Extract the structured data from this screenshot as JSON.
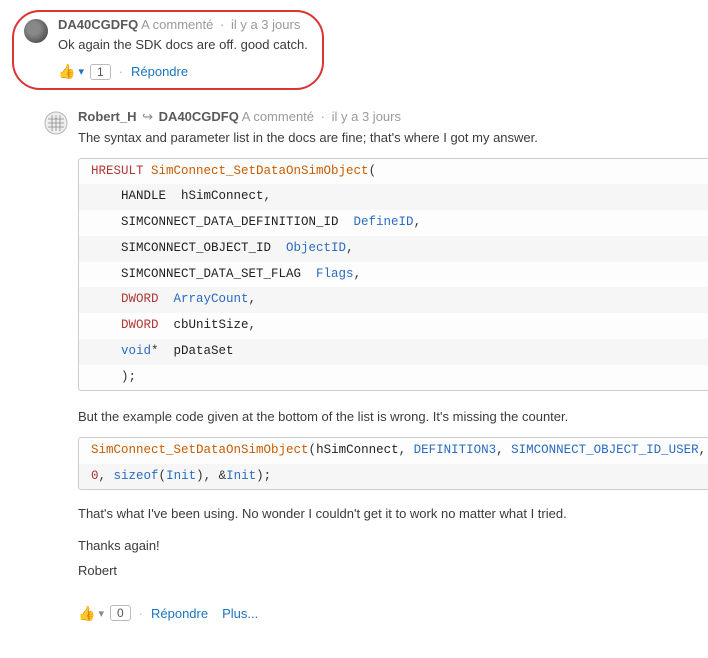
{
  "comments": [
    {
      "author": "DA40CGDFQ",
      "action": "A commenté",
      "time": "il y a 3 jours",
      "text": "Ok again the SDK docs are off. good catch.",
      "vote_count": "1",
      "reply_label": "Répondre"
    },
    {
      "author": "Robert_H",
      "reply_to": "DA40CGDFQ",
      "action": "A commenté",
      "time": "il y a 3 jours",
      "intro": "The syntax and parameter list in the docs are fine; that's where I got my answer.",
      "mid_para": "But the example code given at the bottom of the list is wrong. It's missing the counter.",
      "out_para": "That's what I've been using. No wonder I couldn't get it to work no matter what I tried.",
      "thanks": "Thanks again!",
      "sig": "Robert",
      "vote_count": "0",
      "reply_label": "Répondre",
      "more_label": "Plus..."
    }
  ],
  "code_block_1": [
    [
      [
        "t-type",
        "HRESULT "
      ],
      [
        "t-func",
        "SimConnect_SetDataOnSimObject"
      ],
      [
        "t-pun",
        "("
      ]
    ],
    [
      [
        "t-par",
        "    HANDLE  hSimConnect"
      ],
      [
        "t-pun",
        ","
      ]
    ],
    [
      [
        "t-par",
        "    SIMCONNECT_DATA_DEFINITION_ID  "
      ],
      [
        "t-id",
        "DefineID"
      ],
      [
        "t-pun",
        ","
      ]
    ],
    [
      [
        "t-par",
        "    SIMCONNECT_OBJECT_ID  "
      ],
      [
        "t-id",
        "ObjectID"
      ],
      [
        "t-pun",
        ","
      ]
    ],
    [
      [
        "t-par",
        "    SIMCONNECT_DATA_SET_FLAG  "
      ],
      [
        "t-id",
        "Flags"
      ],
      [
        "t-pun",
        ","
      ]
    ],
    [
      [
        "t-type",
        "    DWORD  "
      ],
      [
        "t-id",
        "ArrayCount"
      ],
      [
        "t-pun",
        ","
      ]
    ],
    [
      [
        "t-type",
        "    DWORD  "
      ],
      [
        "t-par",
        "cbUnitSize"
      ],
      [
        "t-pun",
        ","
      ]
    ],
    [
      [
        "t-kw",
        "    void"
      ],
      [
        "t-pun",
        "*  "
      ],
      [
        "t-par",
        "pDataSet"
      ]
    ],
    [
      [
        "t-pun",
        "    );"
      ]
    ]
  ],
  "code_block_2": [
    [
      [
        "t-func",
        "SimConnect_SetDataOnSimObject"
      ],
      [
        "t-pun",
        "("
      ],
      [
        "t-par",
        "hSimConnect"
      ],
      [
        "t-pun",
        ", "
      ],
      [
        "t-id",
        "DEFINITION3"
      ],
      [
        "t-pun",
        ", "
      ],
      [
        "t-id",
        "SIMCONNECT_OBJECT_ID_USER"
      ],
      [
        "t-pun",
        ","
      ]
    ],
    [
      [
        "t-num",
        "0"
      ],
      [
        "t-pun",
        ", "
      ],
      [
        "t-kw",
        "sizeof"
      ],
      [
        "t-pun",
        "("
      ],
      [
        "t-id",
        "Init"
      ],
      [
        "t-pun",
        "), &"
      ],
      [
        "t-id",
        "Init"
      ],
      [
        "t-pun",
        ");"
      ]
    ]
  ]
}
